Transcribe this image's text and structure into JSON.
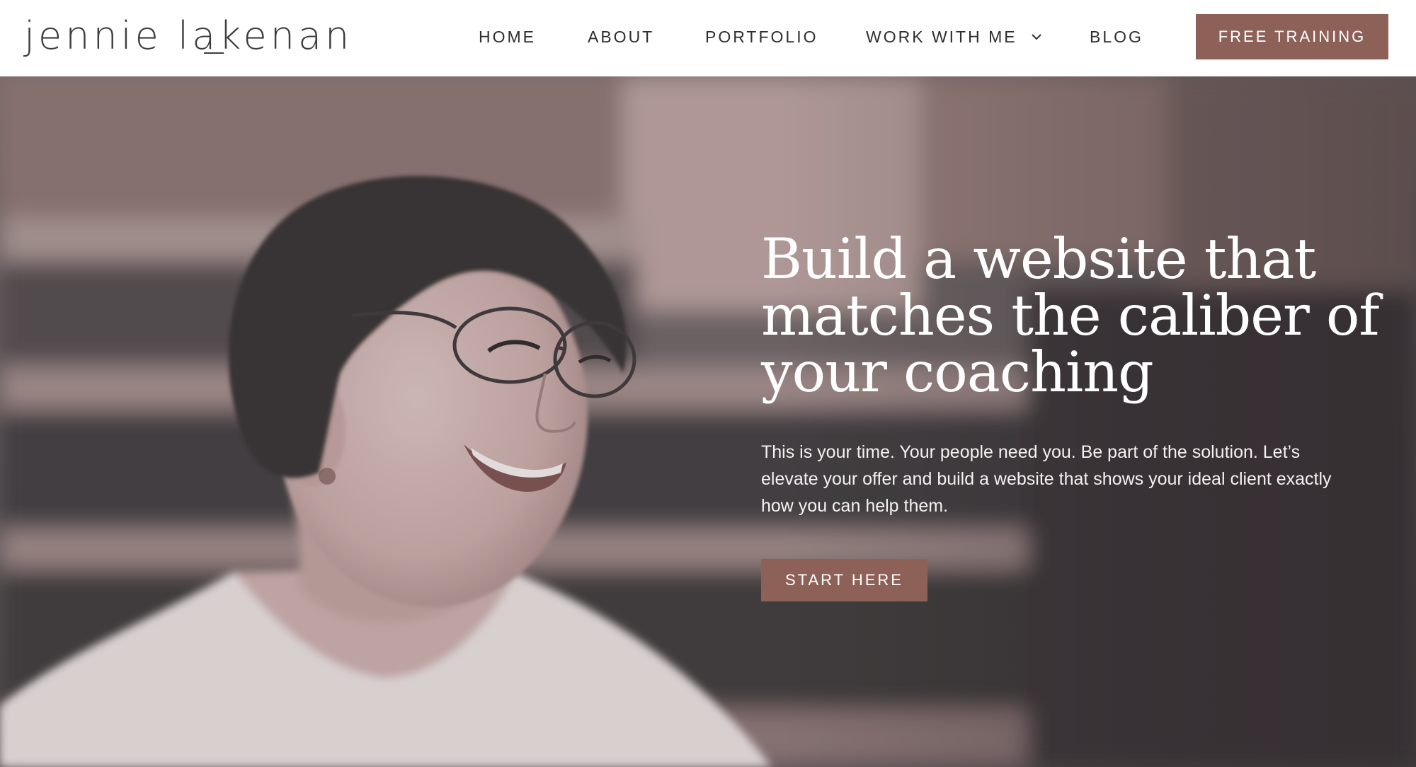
{
  "brand": {
    "logo_text": "jennie lakenan",
    "accent_color": "#8e6158"
  },
  "nav": {
    "items": [
      {
        "label": "HOME"
      },
      {
        "label": "ABOUT"
      },
      {
        "label": "PORTFOLIO"
      },
      {
        "label": "WORK WITH ME",
        "has_dropdown": true
      },
      {
        "label": "BLOG"
      }
    ],
    "cta_label": "FREE TRAINING"
  },
  "hero": {
    "headline": "Build a website that matches the caliber of your coaching",
    "subtext": "This is your time. Your people need you. Be part of the solution. Let’s elevate your offer and build a website that shows your ideal client exactly how you can help them.",
    "cta_label": "START HERE"
  }
}
